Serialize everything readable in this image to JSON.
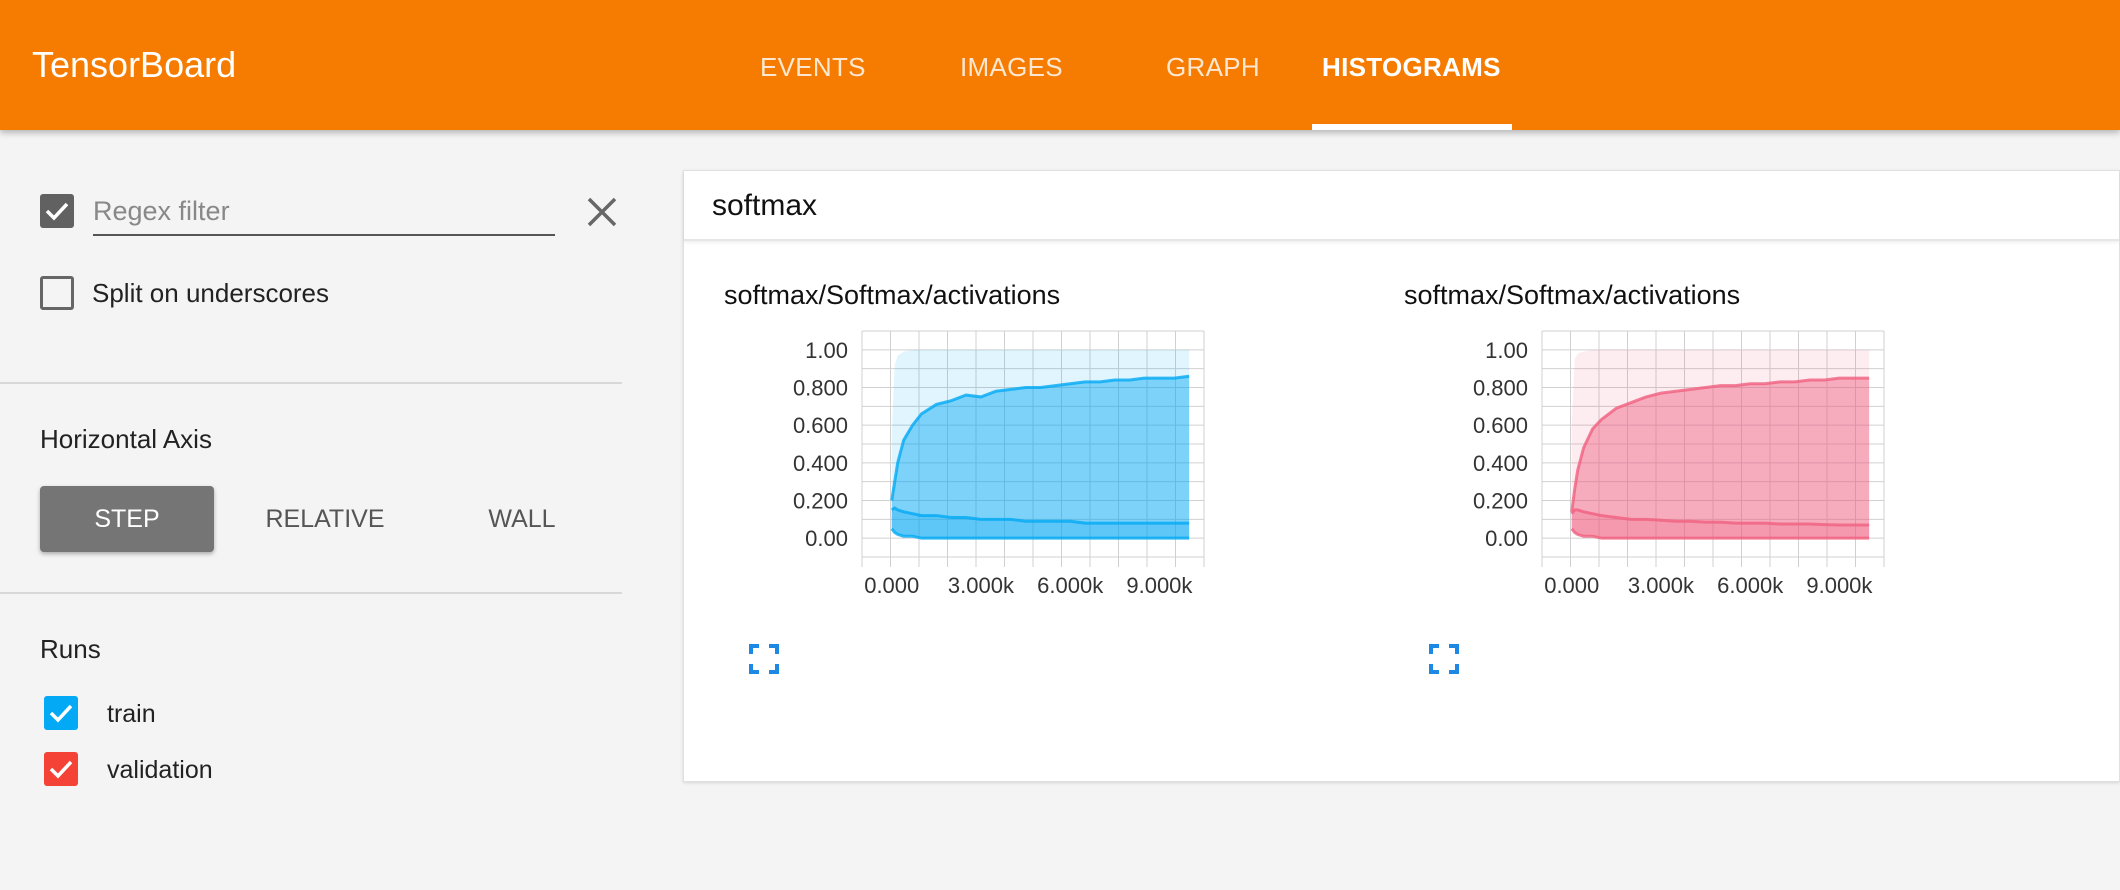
{
  "app": {
    "title": "TensorBoard"
  },
  "nav": {
    "tabs": [
      {
        "label": "EVENTS",
        "active": false
      },
      {
        "label": "IMAGES",
        "active": false
      },
      {
        "label": "GRAPH",
        "active": false
      },
      {
        "label": "HISTOGRAMS",
        "active": true
      }
    ]
  },
  "sidebar": {
    "regex_filter": {
      "checked": true,
      "placeholder": "Regex filter",
      "value": ""
    },
    "split_underscores": {
      "checked": false,
      "label": "Split on underscores"
    },
    "horizontal_axis": {
      "title": "Horizontal Axis",
      "options": [
        {
          "label": "STEP",
          "active": true
        },
        {
          "label": "RELATIVE",
          "active": false
        },
        {
          "label": "WALL",
          "active": false
        }
      ]
    },
    "runs": {
      "title": "Runs",
      "items": [
        {
          "label": "train",
          "checked": true,
          "color": "#03a9f4"
        },
        {
          "label": "validation",
          "checked": true,
          "color": "#f44336"
        }
      ]
    }
  },
  "panel": {
    "title": "softmax",
    "charts": [
      {
        "title": "softmax/Softmax/activations"
      },
      {
        "title": "softmax/Softmax/activations"
      }
    ]
  },
  "chart_data": [
    {
      "type": "area",
      "title": "softmax/Softmax/activations",
      "run": "train",
      "color": "#03a9f4",
      "xlim": [
        -1000,
        10500
      ],
      "ylim": [
        -0.1,
        1.1
      ],
      "x_ticks": [
        0,
        3000,
        6000,
        9000
      ],
      "x_tick_labels": [
        "0.000",
        "3.000k",
        "6.000k",
        "9.000k"
      ],
      "y_ticks": [
        1.0,
        0.8,
        0.6,
        0.4,
        0.2,
        0.0
      ],
      "y_tick_labels": [
        "1.00",
        "0.800",
        "0.600",
        "0.400",
        "0.200",
        "0.00"
      ],
      "grid": true,
      "x": [
        0,
        100,
        200,
        400,
        700,
        1000,
        1500,
        2000,
        2500,
        3000,
        3500,
        4000,
        4500,
        5000,
        5500,
        6000,
        6500,
        7000,
        7500,
        8000,
        8500,
        9000,
        9500,
        10000
      ],
      "series": [
        {
          "name": "max",
          "values": [
            0.55,
            0.92,
            0.97,
            0.99,
            1.0,
            1.0,
            1.0,
            1.0,
            1.0,
            1.0,
            1.0,
            1.0,
            1.0,
            1.0,
            1.0,
            1.0,
            1.0,
            1.0,
            1.0,
            1.0,
            1.0,
            1.0,
            1.0,
            1.0
          ]
        },
        {
          "name": "upper",
          "values": [
            0.2,
            0.3,
            0.4,
            0.52,
            0.6,
            0.66,
            0.71,
            0.73,
            0.76,
            0.75,
            0.78,
            0.79,
            0.8,
            0.8,
            0.81,
            0.82,
            0.83,
            0.83,
            0.84,
            0.84,
            0.85,
            0.85,
            0.85,
            0.86
          ]
        },
        {
          "name": "middle",
          "values": [
            0.15,
            0.16,
            0.15,
            0.14,
            0.13,
            0.12,
            0.12,
            0.11,
            0.11,
            0.1,
            0.1,
            0.1,
            0.09,
            0.09,
            0.09,
            0.09,
            0.08,
            0.08,
            0.08,
            0.08,
            0.08,
            0.08,
            0.08,
            0.08
          ]
        },
        {
          "name": "lower",
          "values": [
            0.05,
            0.03,
            0.02,
            0.01,
            0.01,
            0.0,
            0.0,
            0.0,
            0.0,
            0.0,
            0.0,
            0.0,
            0.0,
            0.0,
            0.0,
            0.0,
            0.0,
            0.0,
            0.0,
            0.0,
            0.0,
            0.0,
            0.0,
            0.0
          ]
        }
      ]
    },
    {
      "type": "area",
      "title": "softmax/Softmax/activations",
      "run": "validation",
      "color": "#f06080",
      "xlim": [
        -1000,
        10500
      ],
      "ylim": [
        -0.1,
        1.1
      ],
      "x_ticks": [
        0,
        3000,
        6000,
        9000
      ],
      "x_tick_labels": [
        "0.000",
        "3.000k",
        "6.000k",
        "9.000k"
      ],
      "y_ticks": [
        1.0,
        0.8,
        0.6,
        0.4,
        0.2,
        0.0
      ],
      "y_tick_labels": [
        "1.00",
        "0.800",
        "0.600",
        "0.400",
        "0.200",
        "0.00"
      ],
      "grid": true,
      "x": [
        0,
        100,
        200,
        400,
        700,
        1000,
        1500,
        2000,
        2500,
        3000,
        3500,
        4000,
        4500,
        5000,
        5500,
        6000,
        6500,
        7000,
        7500,
        8000,
        8500,
        9000,
        9500,
        10000
      ],
      "series": [
        {
          "name": "max",
          "values": [
            0.6,
            0.95,
            0.98,
            0.99,
            1.0,
            1.0,
            1.0,
            1.0,
            1.0,
            1.0,
            1.0,
            1.0,
            1.0,
            1.0,
            1.0,
            1.0,
            1.0,
            1.0,
            1.0,
            1.0,
            1.0,
            1.0,
            1.0,
            1.0
          ]
        },
        {
          "name": "upper",
          "values": [
            0.14,
            0.26,
            0.36,
            0.48,
            0.58,
            0.63,
            0.69,
            0.72,
            0.75,
            0.77,
            0.78,
            0.79,
            0.8,
            0.81,
            0.81,
            0.82,
            0.82,
            0.83,
            0.83,
            0.84,
            0.84,
            0.85,
            0.85,
            0.85
          ]
        },
        {
          "name": "middle",
          "values": [
            0.13,
            0.15,
            0.15,
            0.14,
            0.13,
            0.12,
            0.11,
            0.1,
            0.1,
            0.095,
            0.09,
            0.09,
            0.085,
            0.085,
            0.08,
            0.08,
            0.08,
            0.075,
            0.075,
            0.075,
            0.072,
            0.07,
            0.07,
            0.07
          ]
        },
        {
          "name": "lower",
          "values": [
            0.05,
            0.03,
            0.02,
            0.01,
            0.01,
            0.0,
            0.0,
            0.0,
            0.0,
            0.0,
            0.0,
            0.0,
            0.0,
            0.0,
            0.0,
            0.0,
            0.0,
            0.0,
            0.0,
            0.0,
            0.0,
            0.0,
            0.0,
            0.0
          ]
        }
      ]
    }
  ]
}
